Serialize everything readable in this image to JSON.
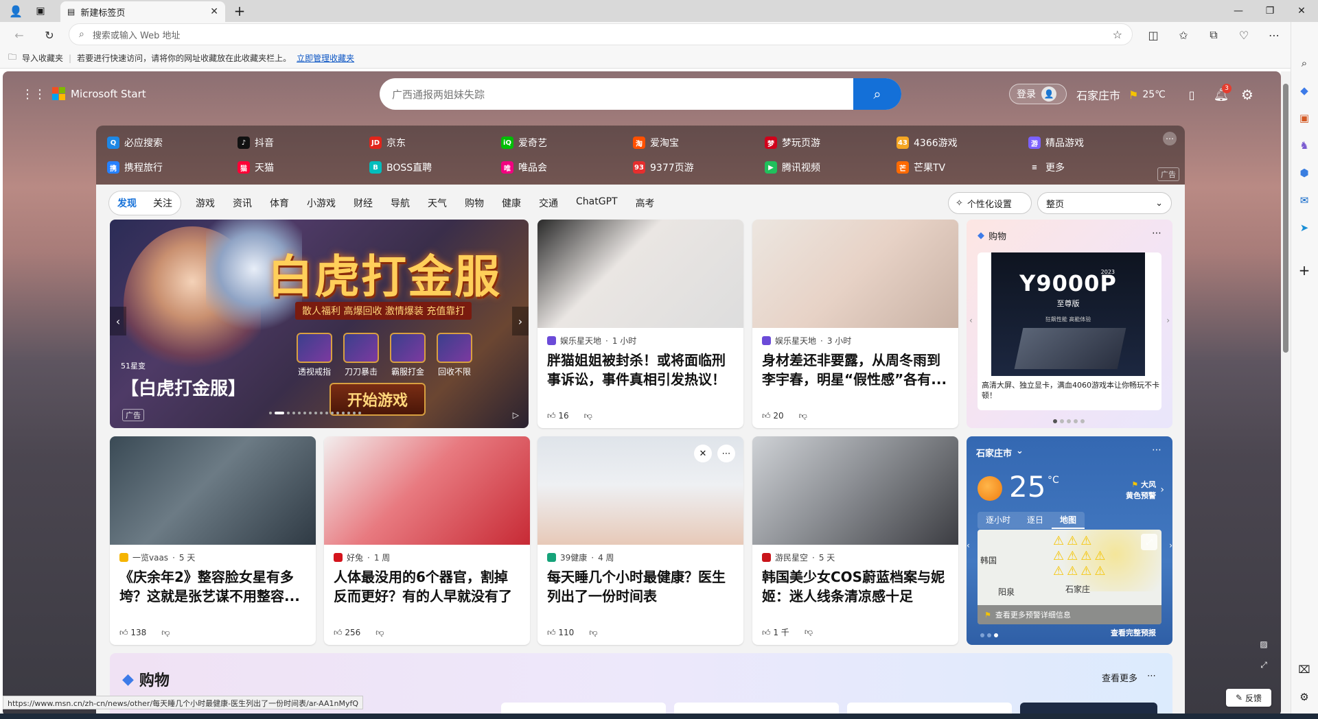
{
  "browser": {
    "tab_title": "新建标签页",
    "address_placeholder": "搜索或输入 Web 地址",
    "favbar_import": "导入收藏夹",
    "favbar_hint": "若要进行快速访问，请将你的网址收藏放在此收藏夹栏上。",
    "favbar_link": "立即管理收藏夹",
    "status_url": "https://www.msn.cn/zh-cn/news/other/每天睡几个小时最健康-医生列出了一份时间表/ar-AA1nMyfQ"
  },
  "msn": {
    "brand": "Microsoft Start",
    "search_placeholder": "广西通报两姐妹失踪",
    "login": "登录",
    "city": "石家庄市",
    "temp_small": "25℃",
    "notif_count": "3"
  },
  "quicklinks": [
    {
      "label": "必应搜索",
      "color": "#1e88e5",
      "glyph": "Q"
    },
    {
      "label": "抖音",
      "color": "#111111",
      "glyph": "♪"
    },
    {
      "label": "京东",
      "color": "#e1251b",
      "glyph": "JD"
    },
    {
      "label": "爱奇艺",
      "color": "#00be06",
      "glyph": "iQ"
    },
    {
      "label": "爱淘宝",
      "color": "#ff5000",
      "glyph": "淘"
    },
    {
      "label": "梦玩页游",
      "color": "#d0021b",
      "glyph": "梦"
    },
    {
      "label": "4366游戏",
      "color": "#f5a623",
      "glyph": "43"
    },
    {
      "label": "精品游戏",
      "color": "#7b61ff",
      "glyph": "游"
    },
    {
      "label": "携程旅行",
      "color": "#2681ff",
      "glyph": "携"
    },
    {
      "label": "天猫",
      "color": "#ff0036",
      "glyph": "猫"
    },
    {
      "label": "BOSS直聘",
      "color": "#00bebd",
      "glyph": "B"
    },
    {
      "label": "唯品会",
      "color": "#f10180",
      "glyph": "唯"
    },
    {
      "label": "9377页游",
      "color": "#e62e2e",
      "glyph": "93"
    },
    {
      "label": "腾讯视频",
      "color": "#20c05c",
      "glyph": "▶"
    },
    {
      "label": "芒果TV",
      "color": "#ff6a00",
      "glyph": "芒"
    },
    {
      "label": "更多",
      "color": "transparent",
      "glyph": "≡"
    }
  ],
  "ql_ad": "广告",
  "nav": {
    "pill": [
      "发现",
      "关注"
    ],
    "tabs": [
      "游戏",
      "资讯",
      "体育",
      "小游戏",
      "财经",
      "导航",
      "天气",
      "购物",
      "健康",
      "交通",
      "ChatGPT",
      "高考"
    ],
    "personalize": "个性化设置",
    "layout_select": "整页"
  },
  "ad": {
    "title": "白虎打金服",
    "sub": "散人福利 高爆回收 激情爆装 充值靠打",
    "badges": [
      "透视戒指",
      "刀刀暴击",
      "霸服打金",
      "回收不限"
    ],
    "start": "开始游戏",
    "brand": "51星变",
    "headline": "【白虎打金服】",
    "ad_label": "广告"
  },
  "cards": [
    {
      "source": "娱乐星天地",
      "time": "1 小时",
      "title": "胖猫姐姐被封杀！或将面临刑事诉讼，事件真相引发热议！",
      "likes": "16",
      "favcolor": "#6b4bd8"
    },
    {
      "source": "娱乐星天地",
      "time": "3 小时",
      "title": "身材差还非要露，从周冬雨到李宇春，明星“假性感”各有...",
      "likes": "20",
      "favcolor": "#6b4bd8"
    },
    {
      "source": "一览vaas",
      "time": "5 天",
      "title": "《庆余年2》整容脸女星有多垮？这就是张艺谋不用整容...",
      "likes": "138",
      "favcolor": "#f5b400"
    },
    {
      "source": "好兔",
      "time": "1 周",
      "title": "人体最没用的6个器官，割掉反而更好？有的人早就没有了",
      "likes": "256",
      "favcolor": "#d4141c"
    },
    {
      "source": "39健康",
      "time": "4 周",
      "title": "每天睡几个小时最健康？医生列出了一份时间表",
      "likes": "110",
      "favcolor": "#16a37a"
    },
    {
      "source": "游民星空",
      "time": "5 天",
      "title": "韩国美少女COS蔚蓝档案与妮姬：迷人线条清凉感十足",
      "likes": "1 千",
      "favcolor": "#c9141a"
    }
  ],
  "shop": {
    "title": "购物",
    "product_brand": "Y9000P",
    "product_year": "2023",
    "product_edition": "至尊版",
    "product_tag": "狂飙性能 高能体验",
    "desc": "高清大屏、独立显卡，满血4060游戏本让你畅玩不卡顿！"
  },
  "weather": {
    "city": "石家庄市",
    "temp": "25",
    "unit": "°C",
    "alert": "大风",
    "alert_level": "黄色预警",
    "tabs": [
      "逐小时",
      "逐日",
      "地图"
    ],
    "map_labels": [
      "韩国",
      "阳泉",
      "石家庄"
    ],
    "more_alerts": "查看更多预警详细信息",
    "full_forecast": "查看完整预报"
  },
  "shopbar": {
    "title": "购物",
    "more": "查看更多"
  },
  "feedback": "反馈"
}
